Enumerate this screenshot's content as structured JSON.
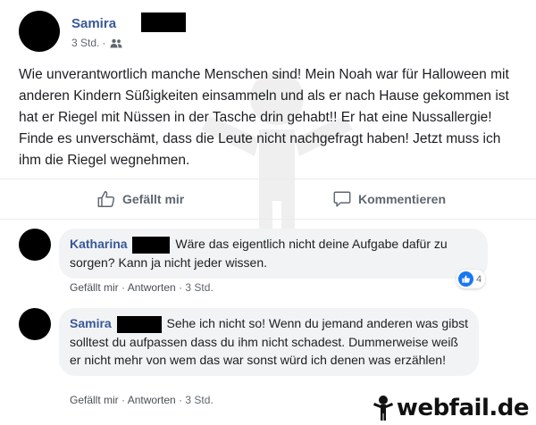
{
  "post": {
    "author": "Samira",
    "time": "3 Std.",
    "separator": "·",
    "audience_icon": "friends-icon",
    "text": "Wie unverantwortlich manche Menschen sind! Mein Noah war für Halloween mit anderen Kindern Süßigkeiten einsammeln und als er nach Hause gekommen ist hat er Riegel mit Nüssen in der Tasche drin gehabt!! Er hat eine Nussallergie! Finde es unverschämt, dass die Leute nicht nachgefragt haben! Jetzt muss ich ihm die Riegel wegnehmen."
  },
  "actions": {
    "like_label": "Gefällt mir",
    "comment_label": "Kommentieren"
  },
  "comments": [
    {
      "author": "Katharina",
      "text": "Wäre das eigentlich nicht deine Aufgabe dafür zu sorgen? Kann ja nicht jeder wissen.",
      "like_label": "Gefällt mir",
      "reply_label": "Antworten",
      "time": "3 Std.",
      "reaction_count": "4"
    },
    {
      "author": "Samira",
      "text": "Sehe ich nicht so! Wenn du jemand anderen was gibst solltest du aufpassen dass du ihm nicht schadest. Dummerweise weiß er nicht mehr von wem das war sonst würd ich denen was erzählen!",
      "like_label": "Gefällt mir",
      "reply_label": "Antworten",
      "time": "3 Std."
    }
  ],
  "watermark": "webfail.de",
  "colors": {
    "name_link": "#385898",
    "meta_gray": "#616770",
    "bubble_bg": "#f2f3f5",
    "like_blue": "#1877f2"
  }
}
